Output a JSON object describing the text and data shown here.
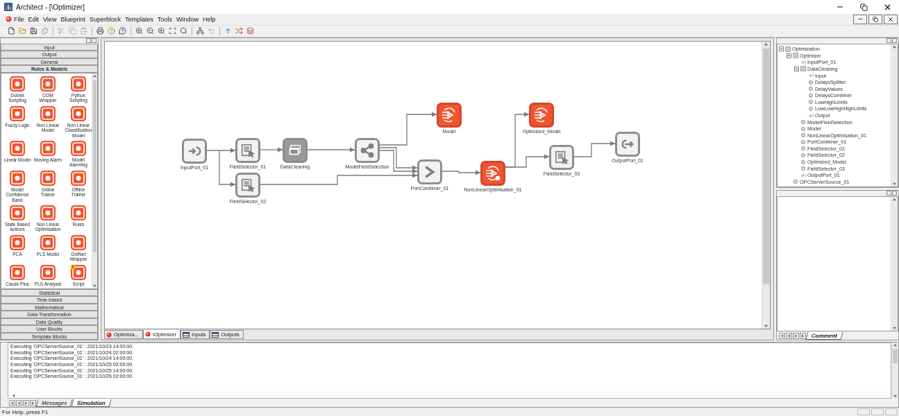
{
  "window": {
    "title": "Architect - [\\Optimizer]"
  },
  "menu": [
    "File",
    "Edit",
    "View",
    "Blueprint",
    "Superblock",
    "Templates",
    "Tools",
    "Window",
    "Help"
  ],
  "palette": {
    "categories": [
      {
        "label": "Input",
        "expanded": false
      },
      {
        "label": "Output",
        "expanded": false
      },
      {
        "label": "General",
        "expanded": false
      },
      {
        "label": "Rules & Models",
        "expanded": true,
        "items": [
          {
            "label": "Dotnet Scripting",
            "warning": false
          },
          {
            "label": "COM Wrapper",
            "warning": false
          },
          {
            "label": "Python Scripting",
            "warning": false
          },
          {
            "label": "Fuzzy Logic",
            "warning": false
          },
          {
            "label": "Non Linear Model",
            "warning": false
          },
          {
            "label": "Non Linear Classification Model",
            "warning": false
          },
          {
            "label": "Linear Model",
            "warning": false
          },
          {
            "label": "Moving Alarm",
            "warning": false
          },
          {
            "label": "Model Alarming",
            "warning": false
          },
          {
            "label": "Model Confidence Band",
            "warning": false
          },
          {
            "label": "Online Trainer",
            "warning": false
          },
          {
            "label": "Offline Trainer",
            "warning": false
          },
          {
            "label": "State Based Actions",
            "warning": false
          },
          {
            "label": "Non Linear Optimisation",
            "warning": false
          },
          {
            "label": "Rules",
            "warning": false
          },
          {
            "label": "PCA",
            "warning": false
          },
          {
            "label": "PLS Model",
            "warning": false
          },
          {
            "label": "DotNet Wrapper",
            "warning": false
          },
          {
            "label": "Cause Plus",
            "warning": false
          },
          {
            "label": "PLS Analysis",
            "warning": false
          },
          {
            "label": "Script",
            "warning": true
          }
        ]
      },
      {
        "label": "Statistical",
        "expanded": false
      },
      {
        "label": "Time-based",
        "expanded": false
      },
      {
        "label": "Mathematical",
        "expanded": false
      },
      {
        "label": "Data Transformation",
        "expanded": false
      },
      {
        "label": "Data Quality",
        "expanded": false
      },
      {
        "label": "User Blocks",
        "expanded": false
      },
      {
        "label": "Template Blocks",
        "expanded": false
      }
    ]
  },
  "diagram": {
    "nodes": [
      {
        "label": "InputPort_01",
        "kind": "input-port"
      },
      {
        "label": "FieldSelector_01",
        "kind": "selector"
      },
      {
        "label": "DataCleaning",
        "kind": "superblock"
      },
      {
        "label": "ModelFieldSelection",
        "kind": "splitter"
      },
      {
        "label": "Model",
        "kind": "model"
      },
      {
        "label": "FieldSelector_02",
        "kind": "selector"
      },
      {
        "label": "PortCombiner_01",
        "kind": "combiner"
      },
      {
        "label": "NonLinearOptimisation_01",
        "kind": "optimiser"
      },
      {
        "label": "Optimized_Model",
        "kind": "model"
      },
      {
        "label": "FieldSelector_03",
        "kind": "selector"
      },
      {
        "label": "OutputPort_01",
        "kind": "output-port"
      }
    ]
  },
  "document_tabs": [
    {
      "label": "Optimiza...",
      "kind": "diagram",
      "selected": false
    },
    {
      "label": "\\Optimizer",
      "kind": "diagram",
      "selected": true
    },
    {
      "label": "Inputs",
      "kind": "table",
      "selected": false
    },
    {
      "label": "Outputs",
      "kind": "table",
      "selected": false
    }
  ],
  "tree": [
    {
      "label": "Optimization",
      "kind": "group",
      "expanded": true,
      "children": [
        {
          "label": "Optimizer",
          "kind": "group",
          "expanded": true,
          "children": [
            {
              "label": "InputPort_01",
              "kind": "port"
            },
            {
              "label": "DataCleaning",
              "kind": "group",
              "expanded": true,
              "children": [
                {
                  "label": "Input",
                  "kind": "port"
                },
                {
                  "label": "DelaysSplitter",
                  "kind": "block"
                },
                {
                  "label": "DelayValues",
                  "kind": "block"
                },
                {
                  "label": "DelaysCombiner",
                  "kind": "block"
                },
                {
                  "label": "LowHighLimits",
                  "kind": "block"
                },
                {
                  "label": "LowLowHighHighLimits",
                  "kind": "block"
                },
                {
                  "label": "Output",
                  "kind": "port"
                }
              ]
            },
            {
              "label": "ModelFieldSelection",
              "kind": "block"
            },
            {
              "label": "Model",
              "kind": "block"
            },
            {
              "label": "NonLinearOptimisation_01",
              "kind": "block"
            },
            {
              "label": "PortCombiner_01",
              "kind": "block"
            },
            {
              "label": "FieldSelector_01",
              "kind": "block"
            },
            {
              "label": "FieldSelector_02",
              "kind": "block"
            },
            {
              "label": "Optimized_Model",
              "kind": "block"
            },
            {
              "label": "FieldSelector_03",
              "kind": "block"
            },
            {
              "label": "OutputPort_01",
              "kind": "port"
            }
          ]
        },
        {
          "label": "OPCServerSource_01",
          "kind": "block"
        }
      ]
    }
  ],
  "comment_tabs": [
    {
      "label": "Comment",
      "selected": true
    }
  ],
  "log": {
    "lines": [
      "Executing 'OPCServerSource_01' : 2021/10/23 14:00:00.",
      "Executing 'OPCServerSource_01' : 2021/10/24 02:00:00.",
      "Executing 'OPCServerSource_01' : 2021/10/24 14:00:00.",
      "Executing 'OPCServerSource_01' : 2021/10/25 02:00:00.",
      "Executing 'OPCServerSource_01' : 2021/10/25 14:00:00.",
      "Executing 'OPCServerSource_01' : 2021/10/26 02:00:00."
    ],
    "tabs": [
      {
        "label": "Messages",
        "selected": false
      },
      {
        "label": "Simulation",
        "selected": true
      }
    ]
  },
  "status_bar": "For Help, press F1"
}
